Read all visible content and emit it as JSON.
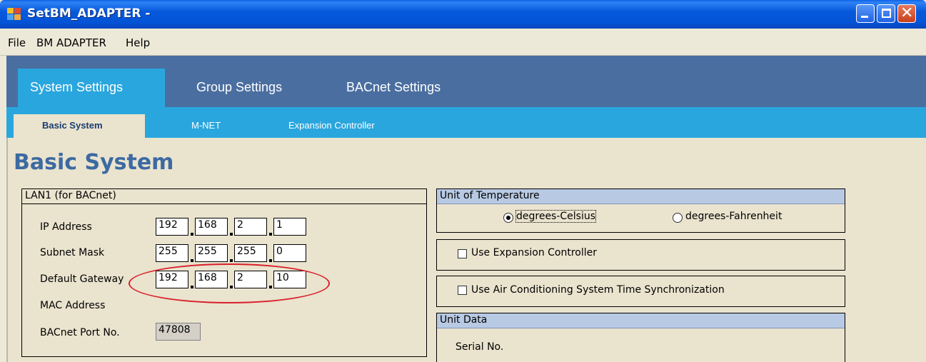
{
  "window": {
    "title": "SetBM_ADAPTER -",
    "controls": {
      "minimize_icon": "minimize-icon",
      "maximize_icon": "maximize-icon",
      "close_icon": "close-icon",
      "close_glyph": "✕"
    }
  },
  "menu": {
    "file": "File",
    "bm_adapter": "BM ADAPTER",
    "help": "Help"
  },
  "main_tabs": [
    "System Settings",
    "Group Settings",
    "BACnet Settings"
  ],
  "sub_tabs": [
    "Basic System",
    "M-NET",
    "Expansion Controller"
  ],
  "page_title": "Basic System",
  "lan": {
    "heading": "LAN1 (for BACnet)",
    "ip_label": "IP Address",
    "ip": [
      "192",
      "168",
      "2",
      "1"
    ],
    "subnet_label": "Subnet Mask",
    "subnet": [
      "255",
      "255",
      "255",
      "0"
    ],
    "gateway_label": "Default Gateway",
    "gateway": [
      "192",
      "168",
      "2",
      "10"
    ],
    "mac_label": "MAC Address",
    "port_label": "BACnet Port No.",
    "port": "47808"
  },
  "temperature": {
    "heading": "Unit of Temperature",
    "celsius": "degrees-Celsius",
    "fahrenheit": "degrees-Fahrenheit",
    "selected": "degrees-Celsius"
  },
  "expansion": {
    "label": "Use Expansion Controller",
    "checked": false
  },
  "time_sync": {
    "label": "Use Air Conditioning System Time Synchronization",
    "checked": false
  },
  "unit_data": {
    "heading": "Unit Data",
    "serial_label": "Serial No."
  },
  "colors": {
    "title_bar": "#0353d6",
    "main_band": "#4a6ea0",
    "sub_band": "#2aa6de",
    "content": "#eae3ce",
    "heading": "#3c6aa2",
    "annotation": "#d8202a"
  }
}
